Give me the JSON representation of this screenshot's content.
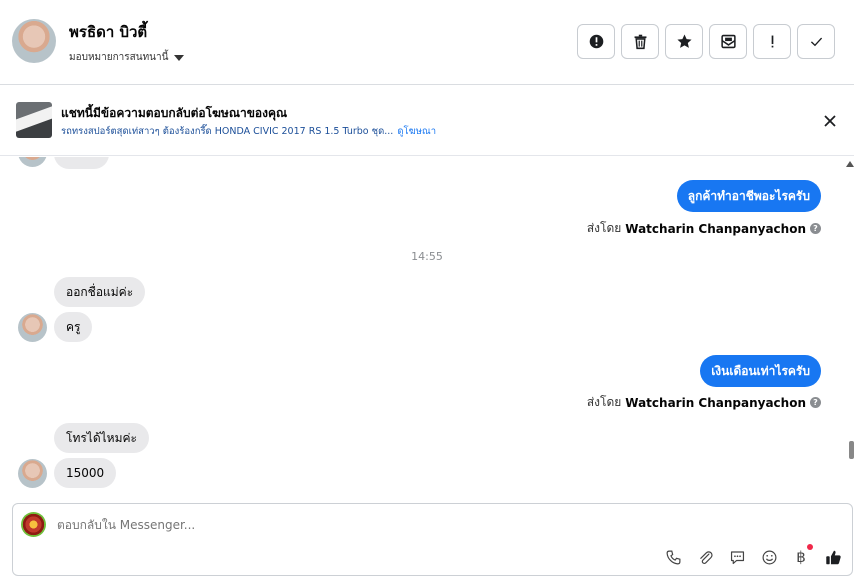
{
  "header": {
    "contact_name": "พรธิดา บิวตี้",
    "assign_label": "มอบหมายการสนทนานี้",
    "toolbar": [
      "report",
      "delete",
      "star",
      "mark-unread",
      "important",
      "done"
    ]
  },
  "ad": {
    "title": "แชทนี้มีข้อความตอบกลับต่อโฆษณาของคุณ",
    "subtitle": "รถทรงสปอร์ตสุดเท่สาวๆ ต้องร้องกรี๊ด HONDA CIVIC 2017 RS 1.5 Turbo ชุด...",
    "link": "ดูโฆษณา"
  },
  "chat": {
    "msg_out_1": "ลูกค้าทำอาชีพอะไรครับ",
    "sent_by_prefix": "ส่งโดย",
    "sent_by_name": "Watcharin Chanpanyachon",
    "timestamp": "14:55",
    "msg_in_1": "ออกชื่อแม่ค่ะ",
    "msg_in_2": "ครู",
    "msg_out_2": "เงินเดือนเท่าไรครับ",
    "msg_in_3": "โทรได้ไหมค่ะ",
    "msg_in_4": "15000"
  },
  "composer": {
    "placeholder": "ตอบกลับใน Messenger...",
    "baht_symbol": "฿"
  },
  "colors": {
    "accent": "#1877f2",
    "incoming_bubble": "#e9e9eb",
    "notification_dot": "#f02849"
  }
}
